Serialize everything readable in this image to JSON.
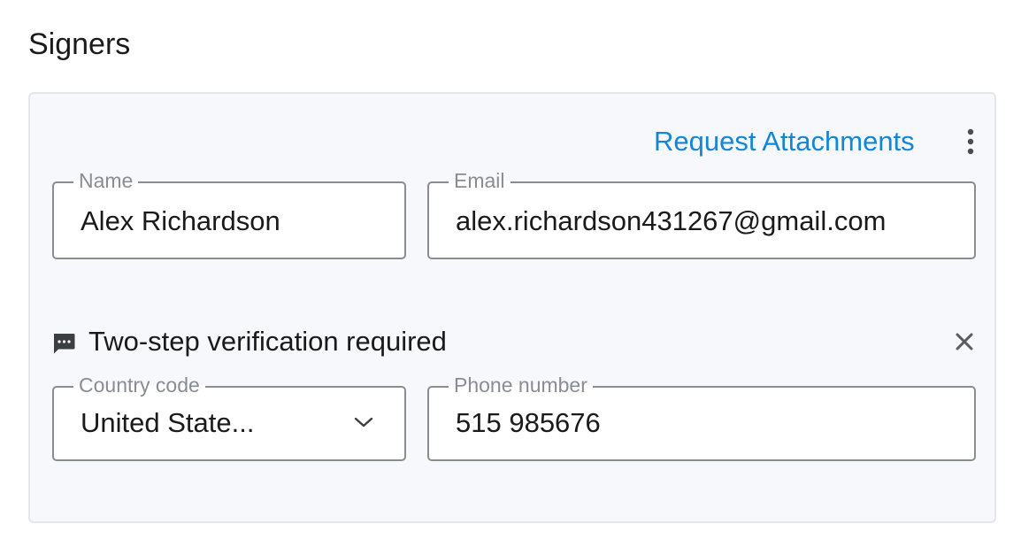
{
  "section": {
    "title": "Signers"
  },
  "card": {
    "request_attachments_label": "Request Attachments",
    "more_options_icon": "kebab-vertical-icon",
    "name_field": {
      "label": "Name",
      "value": "Alex Richardson"
    },
    "email_field": {
      "label": "Email",
      "value": "alex.richardson431267@gmail.com"
    },
    "two_step": {
      "icon": "message-icon",
      "text": "Two-step verification required",
      "close_icon": "close-icon"
    },
    "country_field": {
      "label": "Country code",
      "selected": "United State...",
      "chevron_icon": "chevron-down-icon"
    },
    "phone_field": {
      "label": "Phone number",
      "value": "515 985676"
    }
  },
  "colors": {
    "accent": "#1386d6",
    "card_background": "#f7f8fb",
    "field_border": "#8a8d90",
    "label_gray": "#8a8d90"
  }
}
